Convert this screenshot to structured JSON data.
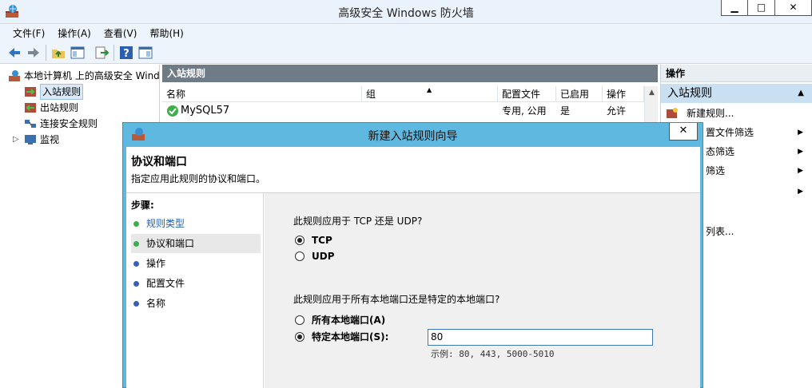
{
  "window": {
    "title": "高级安全 Windows 防火墙",
    "min_label": "▁",
    "max_label": "□",
    "close_label": "✕"
  },
  "menu": [
    {
      "label": "文件(F)"
    },
    {
      "label": "操作(A)"
    },
    {
      "label": "查看(V)"
    },
    {
      "label": "帮助(H)"
    }
  ],
  "toolbar": {
    "icons": [
      "back-arrow-icon",
      "forward-arrow-icon",
      "folder-up-icon",
      "show-hide-tree-icon",
      "export-icon",
      "help-icon",
      "properties-pane-icon"
    ]
  },
  "tree": {
    "root": "本地计算机 上的高级安全 Wind",
    "items": [
      {
        "label": "入站规则",
        "selected": true,
        "icon": "inbound-rules-icon"
      },
      {
        "label": "出站规则",
        "icon": "outbound-rules-icon"
      },
      {
        "label": "连接安全规则",
        "icon": "connection-security-icon"
      },
      {
        "label": "监视",
        "icon": "monitor-icon"
      }
    ]
  },
  "center": {
    "heading": "入站规则",
    "columns": [
      "名称",
      "组",
      "配置文件",
      "已启用",
      "操作"
    ],
    "rows": [
      {
        "name": "MySQL57",
        "group": "",
        "profile": "专用, 公用",
        "enabled": "是",
        "action": "允许"
      }
    ]
  },
  "actions": {
    "heading": "操作",
    "section": "入站规则",
    "items": [
      {
        "label": "新建规则...",
        "submenu": false
      },
      {
        "label": "置文件筛选",
        "submenu": true
      },
      {
        "label": "态筛选",
        "submenu": true
      },
      {
        "label": "筛选",
        "submenu": true
      },
      {
        "label": "",
        "submenu": true
      },
      {
        "label": "列表...",
        "submenu": false
      }
    ]
  },
  "dialog": {
    "title": "新建入站规则向导",
    "close_label": "✕",
    "header": "协议和端口",
    "subheader": "指定应用此规则的协议和端口。",
    "steps_heading": "步骤:",
    "steps": [
      {
        "label": "规则类型",
        "state": "done"
      },
      {
        "label": "协议和端口",
        "state": "current"
      },
      {
        "label": "操作",
        "state": "pending"
      },
      {
        "label": "配置文件",
        "state": "pending"
      },
      {
        "label": "名称",
        "state": "pending"
      }
    ],
    "protocol_question": "此规则应用于 TCP 还是 UDP?",
    "protocol_options": [
      {
        "label": "TCP",
        "selected": true
      },
      {
        "label": "UDP",
        "selected": false
      }
    ],
    "port_question": "此规则应用于所有本地端口还是特定的本地端口?",
    "port_options": [
      {
        "label": "所有本地端口(A)",
        "selected": false
      },
      {
        "label": "特定本地端口(S):",
        "selected": true
      }
    ],
    "port_value": "80",
    "port_example": "示例: 80, 443, 5000-5010"
  },
  "colors": {
    "accent": "#5fb8e0",
    "header_bar": "#6f7c87",
    "selection": "#dbe9f7",
    "link": "#1f5fad",
    "done_dot": "#3fae4a",
    "pending_dot": "#3a5fb5"
  }
}
